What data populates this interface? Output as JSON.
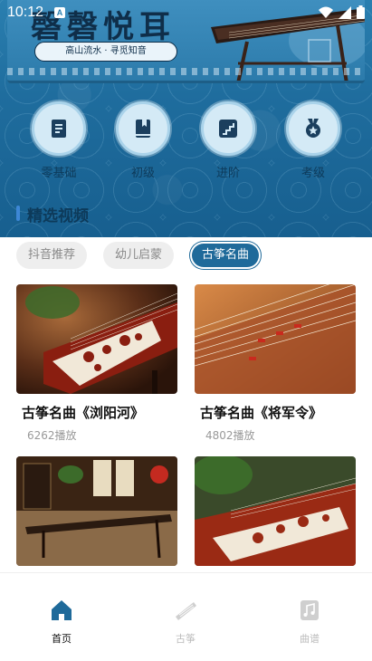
{
  "status_bar": {
    "time": "10:12",
    "a_badge": "A"
  },
  "banner": {
    "title": "磬磬悦耳",
    "subtitle": "高山流水 · 寻觅知音"
  },
  "levels": [
    {
      "label": "零基础",
      "icon": "book-icon"
    },
    {
      "label": "初级",
      "icon": "bookmark-book-icon"
    },
    {
      "label": "进阶",
      "icon": "stairs-icon"
    },
    {
      "label": "考级",
      "icon": "medal-icon"
    }
  ],
  "section": {
    "title": "精选视频"
  },
  "tabs": [
    {
      "label": "抖音推荐",
      "active": false
    },
    {
      "label": "幼儿启蒙",
      "active": false
    },
    {
      "label": "古筝名曲",
      "active": true
    }
  ],
  "videos": [
    {
      "title": "古筝名曲《浏阳河》",
      "plays": "6262播放"
    },
    {
      "title": "古筝名曲《将军令》",
      "plays": "4802播放"
    },
    {
      "title": "",
      "plays": ""
    },
    {
      "title": "",
      "plays": ""
    }
  ],
  "bottom_nav": [
    {
      "label": "首页",
      "icon": "home-icon",
      "active": true
    },
    {
      "label": "古筝",
      "icon": "guzheng-icon",
      "active": false
    },
    {
      "label": "曲谱",
      "icon": "sheet-music-icon",
      "active": false
    }
  ],
  "colors": {
    "primary": "#1f6a9a",
    "hero_bg": "#2a7fb0",
    "active_nav": "#1f6a9a",
    "inactive_nav": "#bbbbbb"
  }
}
